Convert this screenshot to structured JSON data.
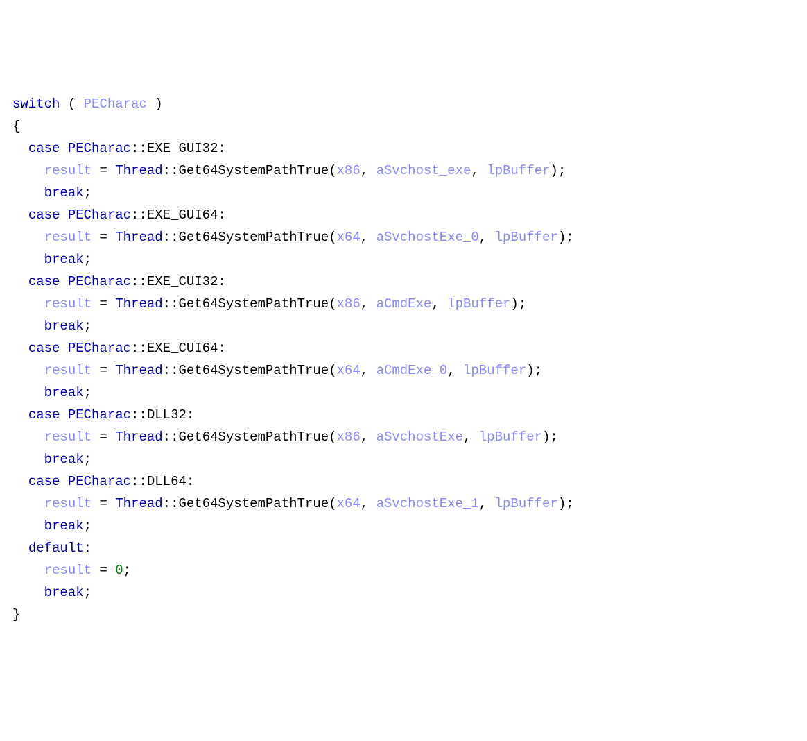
{
  "code": {
    "switch_kw": "switch",
    "switch_var": "PECharac",
    "open_brace": "{",
    "close_brace": "}",
    "case_kw": "case",
    "break_kw": "break",
    "default_kw": "default",
    "result": "result",
    "eq": "=",
    "zero": "0",
    "thread": "Thread",
    "scope_op": "::",
    "func": "Get64SystemPathTrue",
    "pecharac": "PECharac",
    "cases": {
      "c1": {
        "label": "EXE_GUI32",
        "a1": "x86",
        "a2": "aSvchost_exe",
        "a3": "lpBuffer"
      },
      "c2": {
        "label": "EXE_GUI64",
        "a1": "x64",
        "a2": "aSvchostExe_0",
        "a3": "lpBuffer"
      },
      "c3": {
        "label": "EXE_CUI32",
        "a1": "x86",
        "a2": "aCmdExe",
        "a3": "lpBuffer"
      },
      "c4": {
        "label": "EXE_CUI64",
        "a1": "x64",
        "a2": "aCmdExe_0",
        "a3": "lpBuffer"
      },
      "c5": {
        "label": "DLL32",
        "a1": "x86",
        "a2": "aSvchostExe",
        "a3": "lpBuffer"
      },
      "c6": {
        "label": "DLL64",
        "a1": "x64",
        "a2": "aSvchostExe_1",
        "a3": "lpBuffer"
      }
    }
  }
}
